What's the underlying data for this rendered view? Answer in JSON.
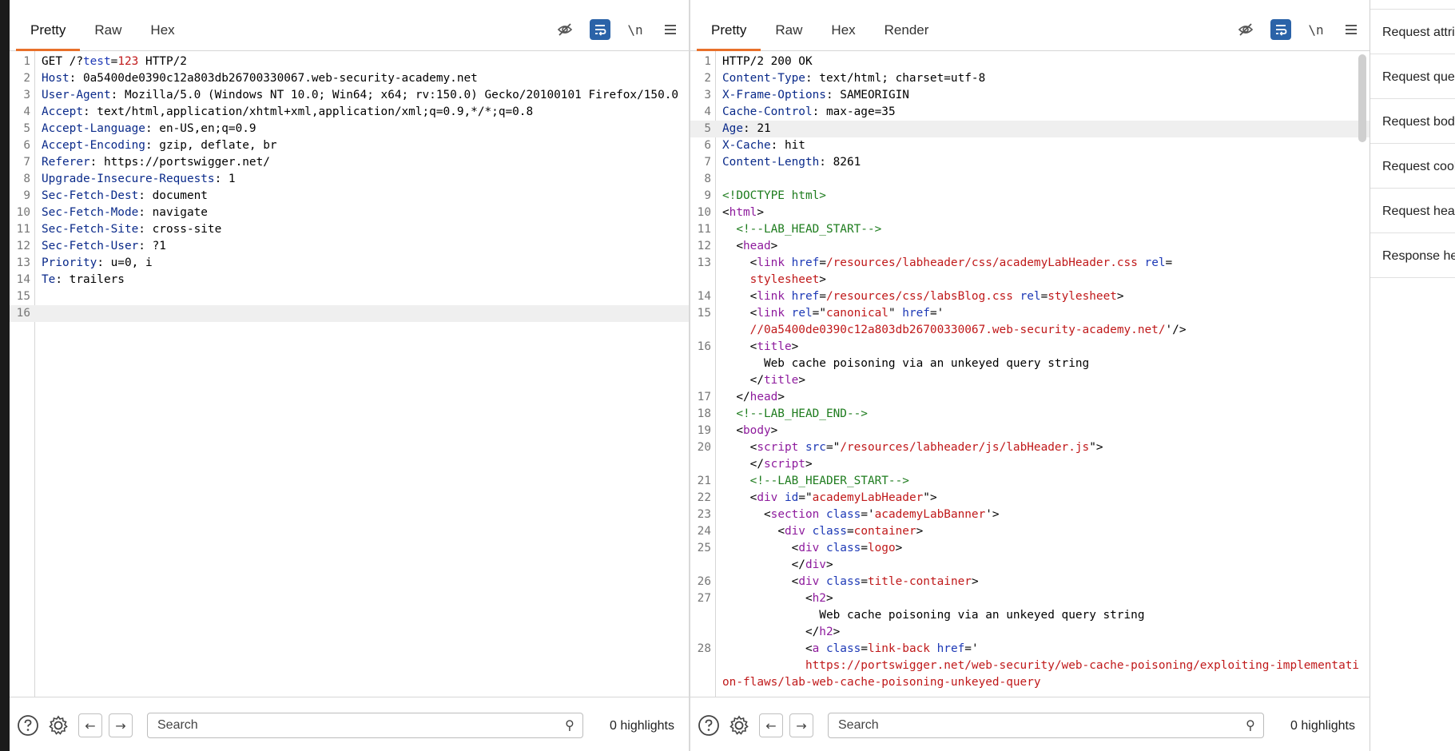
{
  "request": {
    "tabs": [
      {
        "label": "Pretty",
        "active": true
      },
      {
        "label": "Raw",
        "active": false
      },
      {
        "label": "Hex",
        "active": false
      }
    ],
    "tools": {
      "newline_label": "\\n"
    },
    "lines": [
      {
        "n": "1",
        "parts": [
          [
            "v",
            "GET /?"
          ],
          [
            "a",
            "test"
          ],
          [
            "v",
            "="
          ],
          [
            "r",
            "123"
          ],
          [
            "v",
            " HTTP/2"
          ]
        ]
      },
      {
        "n": "2",
        "parts": [
          [
            "h",
            "Host"
          ],
          [
            "v",
            ": 0a5400de0390c12a803db26700330067.web-security-academy.net"
          ]
        ]
      },
      {
        "n": "3",
        "parts": [
          [
            "h",
            "User-Agent"
          ],
          [
            "v",
            ": Mozilla/5.0 (Windows NT 10.0; Win64; x64; rv:150.0) Gecko/20100101 Firefox/150.0"
          ]
        ]
      },
      {
        "n": "4",
        "parts": [
          [
            "h",
            "Accept"
          ],
          [
            "v",
            ": text/html,application/xhtml+xml,application/xml;q=0.9,*/*;q=0.8"
          ]
        ]
      },
      {
        "n": "5",
        "parts": [
          [
            "h",
            "Accept-Language"
          ],
          [
            "v",
            ": en-US,en;q=0.9"
          ]
        ]
      },
      {
        "n": "6",
        "parts": [
          [
            "h",
            "Accept-Encoding"
          ],
          [
            "v",
            ": gzip, deflate, br"
          ]
        ]
      },
      {
        "n": "7",
        "parts": [
          [
            "h",
            "Referer"
          ],
          [
            "v",
            ": https://portswigger.net/"
          ]
        ]
      },
      {
        "n": "8",
        "parts": [
          [
            "h",
            "Upgrade-Insecure-Requests"
          ],
          [
            "v",
            ": 1"
          ]
        ]
      },
      {
        "n": "9",
        "parts": [
          [
            "h",
            "Sec-Fetch-Dest"
          ],
          [
            "v",
            ": document"
          ]
        ]
      },
      {
        "n": "10",
        "parts": [
          [
            "h",
            "Sec-Fetch-Mode"
          ],
          [
            "v",
            ": navigate"
          ]
        ]
      },
      {
        "n": "11",
        "parts": [
          [
            "h",
            "Sec-Fetch-Site"
          ],
          [
            "v",
            ": cross-site"
          ]
        ]
      },
      {
        "n": "12",
        "parts": [
          [
            "h",
            "Sec-Fetch-User"
          ],
          [
            "v",
            ": ?1"
          ]
        ]
      },
      {
        "n": "13",
        "parts": [
          [
            "h",
            "Priority"
          ],
          [
            "v",
            ": u=0, i"
          ]
        ]
      },
      {
        "n": "14",
        "parts": [
          [
            "h",
            "Te"
          ],
          [
            "v",
            ": trailers"
          ]
        ]
      },
      {
        "n": "15",
        "parts": []
      },
      {
        "n": "16",
        "parts": [],
        "highlight": true
      }
    ],
    "search": {
      "placeholder": "Search",
      "highlights": "0 highlights"
    }
  },
  "response": {
    "tabs": [
      {
        "label": "Pretty",
        "active": true
      },
      {
        "label": "Raw",
        "active": false
      },
      {
        "label": "Hex",
        "active": false
      },
      {
        "label": "Render",
        "active": false
      }
    ],
    "tools": {
      "newline_label": "\\n"
    },
    "lines": [
      {
        "n": "1",
        "parts": [
          [
            "v",
            "HTTP/2 200 OK"
          ]
        ]
      },
      {
        "n": "2",
        "parts": [
          [
            "h",
            "Content-Type"
          ],
          [
            "v",
            ": text/html; charset=utf-8"
          ]
        ]
      },
      {
        "n": "3",
        "parts": [
          [
            "h",
            "X-Frame-Options"
          ],
          [
            "v",
            ": SAMEORIGIN"
          ]
        ]
      },
      {
        "n": "4",
        "parts": [
          [
            "h",
            "Cache-Control"
          ],
          [
            "v",
            ": max-age=35"
          ]
        ]
      },
      {
        "n": "5",
        "parts": [
          [
            "h",
            "Age"
          ],
          [
            "v",
            ": 21"
          ]
        ],
        "highlight": true
      },
      {
        "n": "6",
        "parts": [
          [
            "h",
            "X-Cache"
          ],
          [
            "v",
            ": hit"
          ]
        ]
      },
      {
        "n": "7",
        "parts": [
          [
            "h",
            "Content-Length"
          ],
          [
            "v",
            ": 8261"
          ]
        ]
      },
      {
        "n": "8",
        "parts": []
      },
      {
        "n": "9",
        "parts": [
          [
            "c",
            "<!DOCTYPE html>"
          ]
        ]
      },
      {
        "n": "10",
        "parts": [
          [
            "v",
            "<"
          ],
          [
            "t",
            "html"
          ],
          [
            "v",
            ">"
          ]
        ]
      },
      {
        "n": "11",
        "parts": [
          [
            "v",
            "  "
          ],
          [
            "c",
            "<!--LAB_HEAD_START-->"
          ]
        ]
      },
      {
        "n": "12",
        "parts": [
          [
            "v",
            "  <"
          ],
          [
            "t",
            "head"
          ],
          [
            "v",
            ">"
          ]
        ]
      },
      {
        "n": "13",
        "parts": [
          [
            "v",
            "    <"
          ],
          [
            "t",
            "link"
          ],
          [
            "v",
            " "
          ],
          [
            "a",
            "href"
          ],
          [
            "v",
            "="
          ],
          [
            "s",
            "/resources/labheader/css/academyLabHeader.css"
          ],
          [
            "v",
            " "
          ],
          [
            "a",
            "rel"
          ],
          [
            "v",
            "=\n    "
          ],
          [
            "s",
            "stylesheet"
          ],
          [
            "v",
            ">"
          ]
        ]
      },
      {
        "n": "14",
        "parts": [
          [
            "v",
            "    <"
          ],
          [
            "t",
            "link"
          ],
          [
            "v",
            " "
          ],
          [
            "a",
            "href"
          ],
          [
            "v",
            "="
          ],
          [
            "s",
            "/resources/css/labsBlog.css"
          ],
          [
            "v",
            " "
          ],
          [
            "a",
            "rel"
          ],
          [
            "v",
            "="
          ],
          [
            "s",
            "stylesheet"
          ],
          [
            "v",
            ">"
          ]
        ]
      },
      {
        "n": "15",
        "parts": [
          [
            "v",
            "    <"
          ],
          [
            "t",
            "link"
          ],
          [
            "v",
            " "
          ],
          [
            "a",
            "rel"
          ],
          [
            "v",
            "=\""
          ],
          [
            "s",
            "canonical"
          ],
          [
            "v",
            "\" "
          ],
          [
            "a",
            "href"
          ],
          [
            "v",
            "='\n    "
          ],
          [
            "s",
            "//0a5400de0390c12a803db26700330067.web-security-academy.net/"
          ],
          [
            "v",
            "'/>"
          ]
        ]
      },
      {
        "n": "16",
        "parts": [
          [
            "v",
            "    <"
          ],
          [
            "t",
            "title"
          ],
          [
            "v",
            ">\n      Web cache poisoning via an unkeyed query string\n    </"
          ],
          [
            "t",
            "title"
          ],
          [
            "v",
            ">"
          ]
        ]
      },
      {
        "n": "17",
        "parts": [
          [
            "v",
            "  </"
          ],
          [
            "t",
            "head"
          ],
          [
            "v",
            ">"
          ]
        ]
      },
      {
        "n": "18",
        "parts": [
          [
            "v",
            "  "
          ],
          [
            "c",
            "<!--LAB_HEAD_END-->"
          ]
        ]
      },
      {
        "n": "19",
        "parts": [
          [
            "v",
            "  <"
          ],
          [
            "t",
            "body"
          ],
          [
            "v",
            ">"
          ]
        ]
      },
      {
        "n": "20",
        "parts": [
          [
            "v",
            "    <"
          ],
          [
            "t",
            "script"
          ],
          [
            "v",
            " "
          ],
          [
            "a",
            "src"
          ],
          [
            "v",
            "=\""
          ],
          [
            "s",
            "/resources/labheader/js/labHeader.js"
          ],
          [
            "v",
            "\">\n    </"
          ],
          [
            "t",
            "script"
          ],
          [
            "v",
            ">"
          ]
        ]
      },
      {
        "n": "21",
        "parts": [
          [
            "v",
            "    "
          ],
          [
            "c",
            "<!--LAB_HEADER_START-->"
          ]
        ]
      },
      {
        "n": "22",
        "parts": [
          [
            "v",
            "    <"
          ],
          [
            "t",
            "div"
          ],
          [
            "v",
            " "
          ],
          [
            "a",
            "id"
          ],
          [
            "v",
            "=\""
          ],
          [
            "s",
            "academyLabHeader"
          ],
          [
            "v",
            "\">"
          ]
        ]
      },
      {
        "n": "23",
        "parts": [
          [
            "v",
            "      <"
          ],
          [
            "t",
            "section"
          ],
          [
            "v",
            " "
          ],
          [
            "a",
            "class"
          ],
          [
            "v",
            "='"
          ],
          [
            "s",
            "academyLabBanner"
          ],
          [
            "v",
            "'>"
          ]
        ]
      },
      {
        "n": "24",
        "parts": [
          [
            "v",
            "        <"
          ],
          [
            "t",
            "div"
          ],
          [
            "v",
            " "
          ],
          [
            "a",
            "class"
          ],
          [
            "v",
            "="
          ],
          [
            "s",
            "container"
          ],
          [
            "v",
            ">"
          ]
        ]
      },
      {
        "n": "25",
        "parts": [
          [
            "v",
            "          <"
          ],
          [
            "t",
            "div"
          ],
          [
            "v",
            " "
          ],
          [
            "a",
            "class"
          ],
          [
            "v",
            "="
          ],
          [
            "s",
            "logo"
          ],
          [
            "v",
            ">\n          </"
          ],
          [
            "t",
            "div"
          ],
          [
            "v",
            ">"
          ]
        ]
      },
      {
        "n": "26",
        "parts": [
          [
            "v",
            "          <"
          ],
          [
            "t",
            "div"
          ],
          [
            "v",
            " "
          ],
          [
            "a",
            "class"
          ],
          [
            "v",
            "="
          ],
          [
            "s",
            "title-container"
          ],
          [
            "v",
            ">"
          ]
        ]
      },
      {
        "n": "27",
        "parts": [
          [
            "v",
            "            <"
          ],
          [
            "t",
            "h2"
          ],
          [
            "v",
            ">\n              Web cache poisoning via an unkeyed query string\n            </"
          ],
          [
            "t",
            "h2"
          ],
          [
            "v",
            ">"
          ]
        ]
      },
      {
        "n": "28",
        "parts": [
          [
            "v",
            "            <"
          ],
          [
            "t",
            "a"
          ],
          [
            "v",
            " "
          ],
          [
            "a",
            "class"
          ],
          [
            "v",
            "="
          ],
          [
            "s",
            "link-back"
          ],
          [
            "v",
            " "
          ],
          [
            "a",
            "href"
          ],
          [
            "v",
            "='\n            "
          ],
          [
            "s",
            "https://portswigger.net/web-security/web-cache-poisoning/exploiting-implementation-flaws/lab-web-cache-poisoning-unkeyed-query"
          ]
        ]
      }
    ],
    "search": {
      "placeholder": "Search",
      "highlights": "0 highlights"
    }
  },
  "inspector": {
    "items": [
      "Request attributes",
      "Request query parameters",
      "Request body parameters",
      "Request cookies",
      "Request headers",
      "Response headers"
    ]
  }
}
